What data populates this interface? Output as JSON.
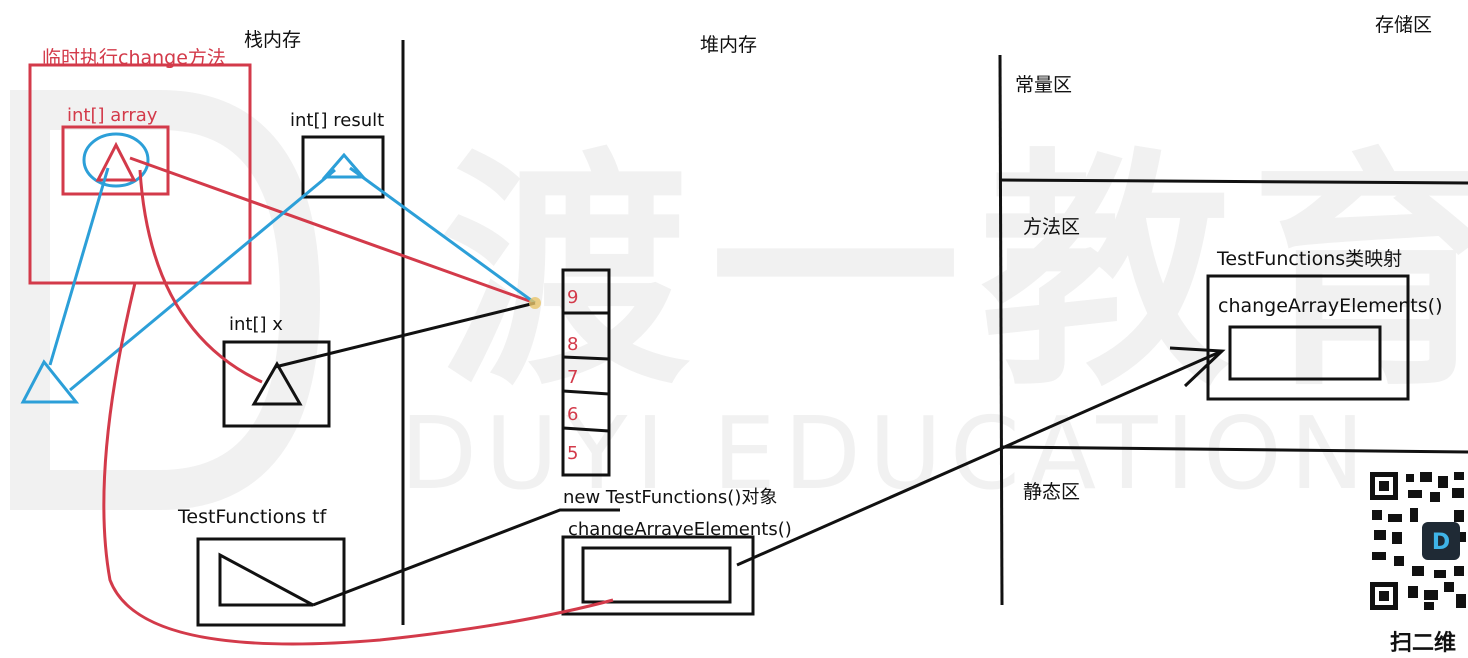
{
  "watermark": {
    "cn": "渡一教育",
    "en": "DUYI EDUCATION"
  },
  "sections": {
    "stack": "栈内存",
    "heap": "堆内存",
    "storage": "存储区",
    "constant": "常量区",
    "method_area": "方法区",
    "static": "静态区"
  },
  "stack_items": {
    "temp_frame": "临时执行change方法",
    "array_param": "int[] array",
    "result": "int[] result",
    "x": "int[]    x",
    "tf": "TestFunctions    tf"
  },
  "heap_array": {
    "values": [
      "9",
      "8",
      "7",
      "6",
      "5"
    ]
  },
  "heap_object": {
    "title": "new TestFunctions()对象",
    "method": "changeArrayeElements()"
  },
  "class_mapping": {
    "title": "TestFunctions类映射",
    "method": "changeArrayElements()"
  },
  "qr": {
    "caption": "扫二维"
  },
  "colors": {
    "red": "#d33a4a",
    "blue": "#2c9fd8",
    "black": "#111111"
  }
}
